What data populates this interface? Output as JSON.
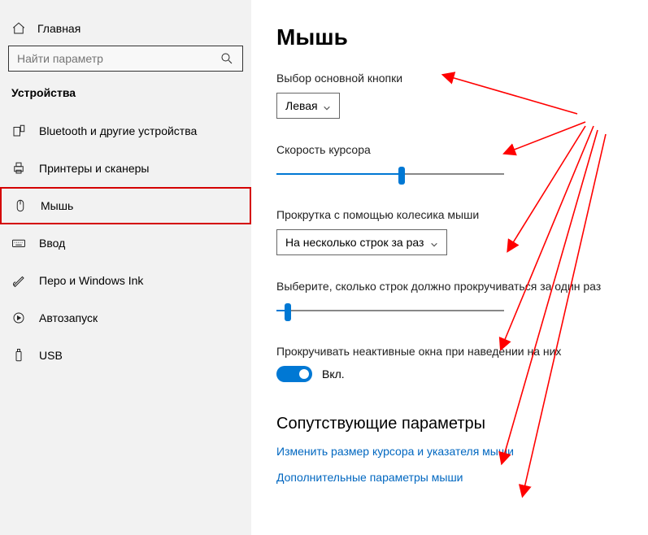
{
  "sidebar": {
    "home": "Главная",
    "search_placeholder": "Найти параметр",
    "category": "Устройства",
    "items": [
      {
        "label": "Bluetooth и другие устройства"
      },
      {
        "label": "Принтеры и сканеры"
      },
      {
        "label": "Мышь"
      },
      {
        "label": "Ввод"
      },
      {
        "label": "Перо и Windows Ink"
      },
      {
        "label": "Автозапуск"
      },
      {
        "label": "USB"
      }
    ]
  },
  "page": {
    "title": "Мышь",
    "primary_button_label": "Выбор основной кнопки",
    "primary_button_value": "Левая",
    "cursor_speed_label": "Скорость курсора",
    "cursor_speed_value": 55,
    "scroll_mode_label": "Прокрутка с помощью колесика мыши",
    "scroll_mode_value": "На несколько строк за раз",
    "lines_label": "Выберите, сколько строк должно прокручиваться за один раз",
    "lines_value": 5,
    "inactive_label": "Прокручивать неактивные окна при наведении на них",
    "inactive_state": "Вкл.",
    "related_title": "Сопутствующие параметры",
    "link1": "Изменить размер курсора и указателя мыши",
    "link2": "Дополнительные параметры мыши"
  },
  "annotation": {
    "highlight_color": "#d40000",
    "arrow_color": "#ff0000"
  }
}
